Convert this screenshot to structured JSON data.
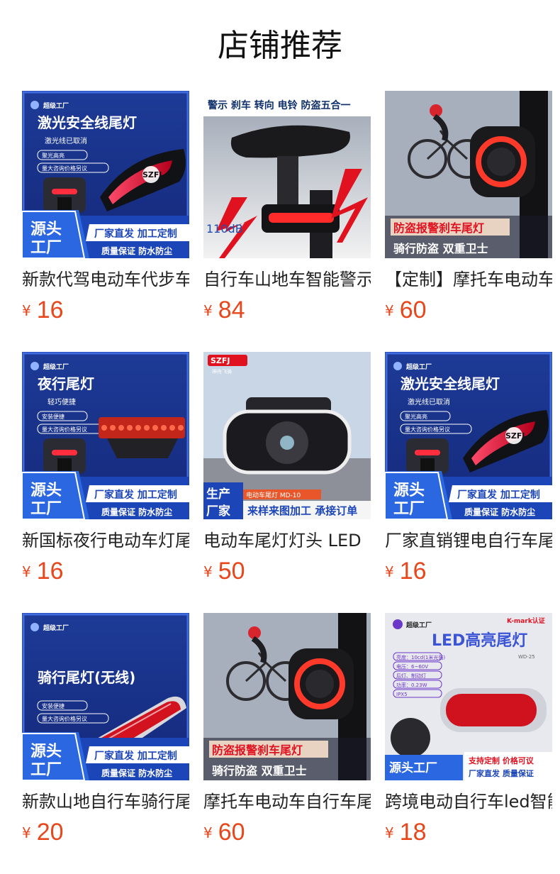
{
  "section": {
    "title": "店铺推荐"
  },
  "currency_symbol": "¥",
  "products": [
    {
      "title": "新款代驾电动车代步车激光安全线尾灯",
      "price": "16",
      "image": {
        "template": "laser",
        "badge": "超级工厂",
        "headline": "激光安全线尾灯",
        "sub": "激光线已取消",
        "pills": [
          "聚光高亮",
          "量大咨询价格另议"
        ],
        "logo": "SZFJ",
        "corner": [
          "源头",
          "工厂"
        ],
        "strip_top": "厂家直发 加工定制",
        "strip_bottom": "质量保证 防水防尘"
      }
    },
    {
      "title": "自行车山地车智能警示尾灯",
      "price": "84",
      "image": {
        "template": "saddle",
        "banner": "警示 刹车 转向 电铃 防盗五合一",
        "db_label": "110dB"
      }
    },
    {
      "title": "【定制】摩托车电动车尾灯",
      "price": "60",
      "image": {
        "template": "ring",
        "line1": "防盗报警刹车尾灯",
        "line2": "骑行防盗 双重卫士"
      }
    },
    {
      "title": "新国标夜行电动车灯尾灯",
      "price": "16",
      "image": {
        "template": "night",
        "badge": "超级工厂",
        "headline": "夜行尾灯",
        "sub": "轻巧便捷",
        "pills": [
          "安装便捷",
          "量大咨询价格另议"
        ],
        "corner": [
          "源头",
          "工厂"
        ],
        "strip_top": "厂家直发 加工定制",
        "strip_bottom": "质量保证 防水防尘"
      }
    },
    {
      "title": "电动车尾灯灯头 LED",
      "price": "50",
      "image": {
        "template": "headlamp",
        "logo": "SZFJ",
        "logo_sub": "神舟飞骑",
        "corner": [
          "生产",
          "厂家"
        ],
        "model": "电动车尾灯 MD-10",
        "bottom": "来样来图加工 承接订单"
      }
    },
    {
      "title": "厂家直销锂电自行车尾灯",
      "price": "16",
      "image": {
        "template": "laser",
        "badge": "超级工厂",
        "headline": "激光安全线尾灯",
        "sub": "激光线已取消",
        "pills": [
          "聚光高亮",
          "量大咨询价格另议"
        ],
        "logo": "SZFJ",
        "corner": [
          "源头",
          "工厂"
        ],
        "strip_top": "厂家直发 加工定制",
        "strip_bottom": "质量保证 防水防尘"
      }
    },
    {
      "title": "新款山地自行车骑行尾灯",
      "price": "20",
      "image": {
        "template": "wireless",
        "badge": "超级工厂",
        "headline": "骑行尾灯(无线)",
        "pills": [
          "安装便捷",
          "量大咨询价格另议"
        ],
        "corner": [
          "源头",
          "工厂"
        ],
        "strip_top": "厂家直发 加工定制",
        "strip_bottom": "质量保证 防水防尘"
      }
    },
    {
      "title": "摩托车电动车自行车尾灯",
      "price": "60",
      "image": {
        "template": "ring",
        "line1": "防盗报警刹车尾灯",
        "line2": "骑行防盗 双重卫士"
      }
    },
    {
      "title": "跨境电动自行车led智能尾灯",
      "price": "18",
      "image": {
        "template": "kmark",
        "badge": "超级工厂",
        "kmark": "K-mark认证",
        "headline": "LED高亮尾灯",
        "model": "WD-25",
        "specs": [
          "亮度：10cd(1米光强)",
          "电压：6~60V",
          "后灯、制动灯",
          "功率：0.23W",
          "IPX5"
        ],
        "corner": "源头工厂",
        "strip_top": "支持定制 价格可议",
        "strip_bottom": "厂家直发 质量保证"
      }
    }
  ]
}
